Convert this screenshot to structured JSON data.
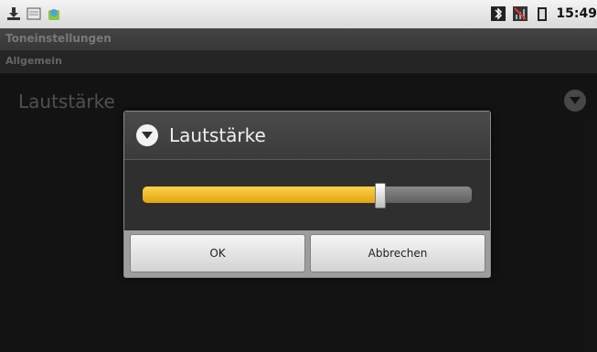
{
  "statusbar": {
    "left_icons": [
      "download-icon",
      "notes-icon",
      "android-market-icon"
    ],
    "right_icons": [
      "bluetooth-icon",
      "signal-muted-icon",
      "battery-icon"
    ],
    "time": "15:49"
  },
  "titlebar": {
    "title": "Toneinstellungen"
  },
  "category": {
    "label": "Allgemein"
  },
  "preference": {
    "title": "Lautstärke"
  },
  "dialog": {
    "title": "Lautstärke",
    "slider": {
      "value_fraction": 0.72,
      "fill_color": "#f2b91a"
    },
    "ok_label": "OK",
    "cancel_label": "Abbrechen"
  }
}
